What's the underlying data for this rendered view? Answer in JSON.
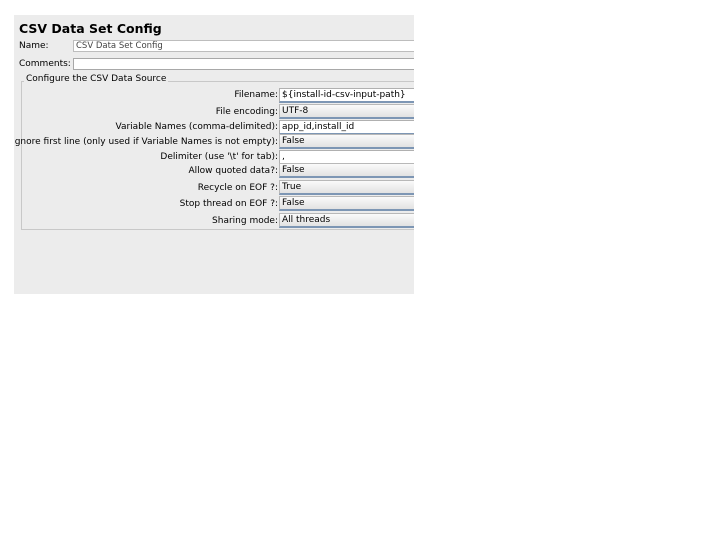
{
  "title": "CSV Data Set Config",
  "name": {
    "label": "Name:",
    "value": "CSV Data Set Config"
  },
  "comments": {
    "label": "Comments:",
    "value": ""
  },
  "group_title": "Configure the CSV Data Source",
  "rows": [
    {
      "label": "Filename:",
      "value": "${install-id-csv-input-path}"
    },
    {
      "label": "File encoding:",
      "value": "UTF-8"
    },
    {
      "label": "Variable Names (comma-delimited):",
      "value": "app_id,install_id"
    },
    {
      "label": "Ignore first line (only used if Variable Names is not empty):",
      "value": "False"
    },
    {
      "label": "Delimiter (use '\\t' for tab):",
      "value": ","
    },
    {
      "label": "Allow quoted data?:",
      "value": "False"
    },
    {
      "label": "Recycle on EOF ?:",
      "value": "True"
    },
    {
      "label": "Stop thread on EOF ?:",
      "value": "False"
    },
    {
      "label": "Sharing mode:",
      "value": "All threads"
    }
  ]
}
